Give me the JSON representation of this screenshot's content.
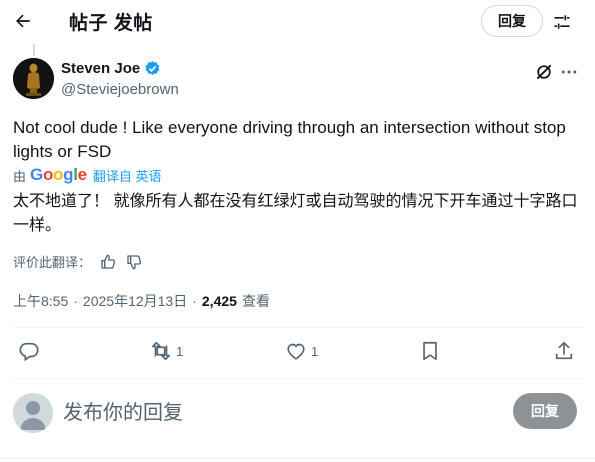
{
  "header": {
    "title": "帖子 发帖",
    "reply_button": "回复",
    "icons": {
      "back": "arrow-left-icon",
      "filter": "sliders-icon"
    }
  },
  "post": {
    "author_name": "Steven Joe",
    "handle": "@Steviejoebrown",
    "verified": true,
    "text": "Not cool dude ! Like everyone driving through an intersection without stop lights or FSD",
    "translation": {
      "by_label": "由",
      "provider": "Google",
      "link_label": "翻译自 英语",
      "text": "太不地道了！ 就像所有人都在没有红绿灯或自动驾驶的情况下开车通过十字路口一样。",
      "rate_label": "评价此翻译："
    },
    "time": "上午8:55",
    "date": "2025年12月13日",
    "separator": "·",
    "views": "2,425",
    "views_label": "查看"
  },
  "actions": {
    "reply_count": "",
    "retweet_count": "1",
    "like_count": "1"
  },
  "composer": {
    "placeholder": "发布你的回复",
    "submit_label": "回复"
  },
  "colors": {
    "accent": "#1d9bf0",
    "text": "#0f1419",
    "muted": "#536471",
    "border": "#eff3f4",
    "disabled_button": "#8d9296"
  }
}
